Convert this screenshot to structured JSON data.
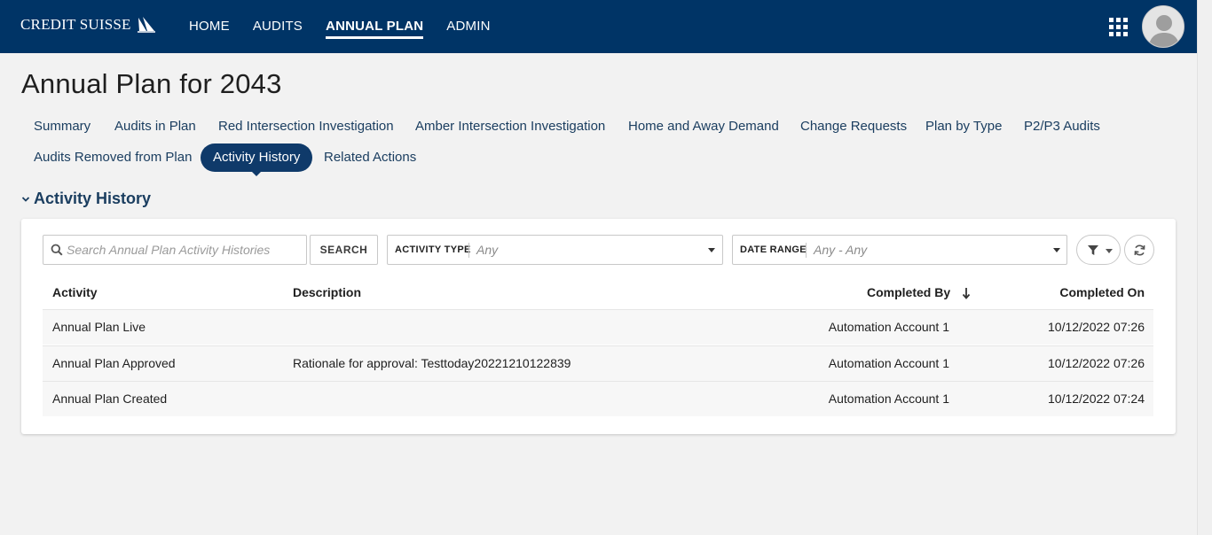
{
  "header": {
    "brand": "CREDIT SUISSE",
    "nav": [
      {
        "label": "HOME",
        "active": false
      },
      {
        "label": "AUDITS",
        "active": false
      },
      {
        "label": "ANNUAL PLAN",
        "active": true
      },
      {
        "label": "ADMIN",
        "active": false
      }
    ],
    "apps_icon": "grid-icon",
    "avatar_icon": "user-avatar-icon"
  },
  "page": {
    "title": "Annual Plan for 2043"
  },
  "tabs": [
    {
      "label": "Summary",
      "active": false
    },
    {
      "label": "Audits in Plan",
      "active": false
    },
    {
      "label": "Red Intersection Investigation",
      "active": false
    },
    {
      "label": "Amber Intersection Investigation",
      "active": false
    },
    {
      "label": "Home and Away Demand",
      "active": false
    },
    {
      "label": "Change Requests",
      "active": false
    },
    {
      "label": "Plan by Type",
      "active": false
    },
    {
      "label": "P2/P3 Audits",
      "active": false
    },
    {
      "label": "Audits Removed from Plan",
      "active": false
    },
    {
      "label": "Activity History",
      "active": true
    },
    {
      "label": "Related Actions",
      "active": false
    }
  ],
  "section": {
    "title": "Activity History",
    "collapse_icon": "chevron-down-icon"
  },
  "toolbar": {
    "search_placeholder": "Search Annual Plan Activity Histories",
    "search_value": "",
    "search_button": "SEARCH",
    "activity_type": {
      "label": "ACTIVITY TYPE",
      "value": "Any"
    },
    "date_range": {
      "label": "DATE RANGE",
      "value": "Any - Any"
    },
    "filter_icon": "funnel-icon",
    "refresh_icon": "refresh-icon"
  },
  "table": {
    "columns": [
      "Activity",
      "Description",
      "Completed By",
      "Completed On"
    ],
    "sort_column": "Completed By",
    "sort_direction": "descending",
    "rows": [
      {
        "activity": "Annual Plan Live",
        "description": "",
        "completed_by": "Automation Account 1",
        "completed_on": "10/12/2022 07:26"
      },
      {
        "activity": "Annual Plan Approved",
        "description": "Rationale for approval: Testtoday20221210122839",
        "completed_by": "Automation Account 1",
        "completed_on": "10/12/2022 07:26"
      },
      {
        "activity": "Annual Plan Created",
        "description": "",
        "completed_by": "Automation Account 1",
        "completed_on": "10/12/2022 07:24"
      }
    ]
  },
  "colors": {
    "header_bg": "#003466",
    "accent": "#0f3a6a",
    "link": "#1b3e60",
    "page_bg": "#f2f2f2"
  }
}
